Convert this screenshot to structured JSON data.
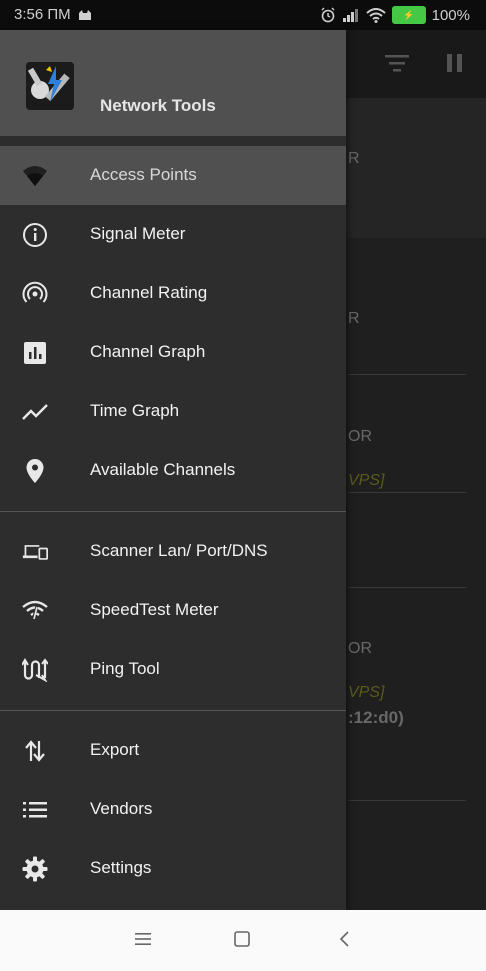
{
  "status_bar": {
    "time": "3:56 ПМ",
    "battery": "100%",
    "icons": [
      "cat-icon",
      "alarm-icon",
      "signal-icon",
      "wifi-icon",
      "battery-icon"
    ]
  },
  "background": {
    "toolbar_icons": [
      "filter-icon",
      "pause-icon"
    ],
    "rows": [
      {
        "text": "R"
      },
      {
        "text": "R"
      },
      {
        "text": "OR"
      },
      {
        "text": "VPS]"
      },
      {
        "text": "OR"
      },
      {
        "text": "VPS]"
      },
      {
        "text": ":12:d0)"
      }
    ]
  },
  "drawer": {
    "title": "Network Tools",
    "groups": [
      {
        "items": [
          {
            "label": "Access Points",
            "icon": "wifi-icon",
            "active": true
          },
          {
            "label": "Signal Meter",
            "icon": "info-icon"
          },
          {
            "label": "Channel Rating",
            "icon": "broadcast-icon"
          },
          {
            "label": "Channel Graph",
            "icon": "bar-chart-icon"
          },
          {
            "label": "Time Graph",
            "icon": "trend-line-icon"
          },
          {
            "label": "Available Channels",
            "icon": "location-pin-icon"
          }
        ]
      },
      {
        "items": [
          {
            "label": "Scanner Lan/ Port/DNS",
            "icon": "devices-icon"
          },
          {
            "label": "SpeedTest Meter",
            "icon": "speed-wifi-icon"
          },
          {
            "label": "Ping Tool",
            "icon": "ping-icon"
          }
        ]
      },
      {
        "items": [
          {
            "label": "Export",
            "icon": "import-export-icon"
          },
          {
            "label": "Vendors",
            "icon": "list-icon"
          },
          {
            "label": "Settings",
            "icon": "gear-icon"
          }
        ]
      }
    ]
  },
  "nav_bar": {
    "buttons": [
      "menu-icon",
      "home-icon",
      "back-icon"
    ]
  },
  "colors": {
    "drawer_bg": "#2d2d2d",
    "header_bg": "#505050",
    "active_bg": "#505050",
    "battery": "#44c845",
    "accent_yellow": "#a3a531"
  }
}
